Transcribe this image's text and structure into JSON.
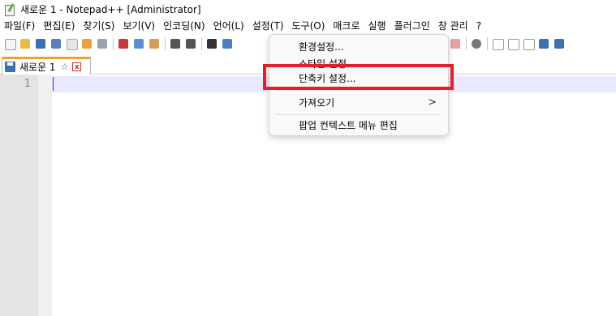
{
  "window": {
    "title": "새로운 1 - Notepad++ [Administrator]"
  },
  "menubar": {
    "items": [
      "파일(F)",
      "편집(E)",
      "찾기(S)",
      "보기(V)",
      "인코딩(N)",
      "언어(L)",
      "설정(T)",
      "도구(O)",
      "매크로",
      "실행",
      "플러그인",
      "창 관리",
      "?"
    ]
  },
  "tab": {
    "label": "새로운 1",
    "pin_icon": "pin-icon",
    "close_icon": "close-icon"
  },
  "editor": {
    "line_number": "1"
  },
  "settings_menu": {
    "items": [
      {
        "label": "환경설정..."
      },
      {
        "label": "스타일 설정..."
      },
      {
        "label": "단축키 설정..."
      },
      {
        "label": "가져오기",
        "submenu_arrow": ">"
      },
      {
        "label": "팝업 컨텍스트 메뉴 편집"
      }
    ]
  },
  "highlight_color": "#e0202a",
  "accent_color": "#8000ff"
}
